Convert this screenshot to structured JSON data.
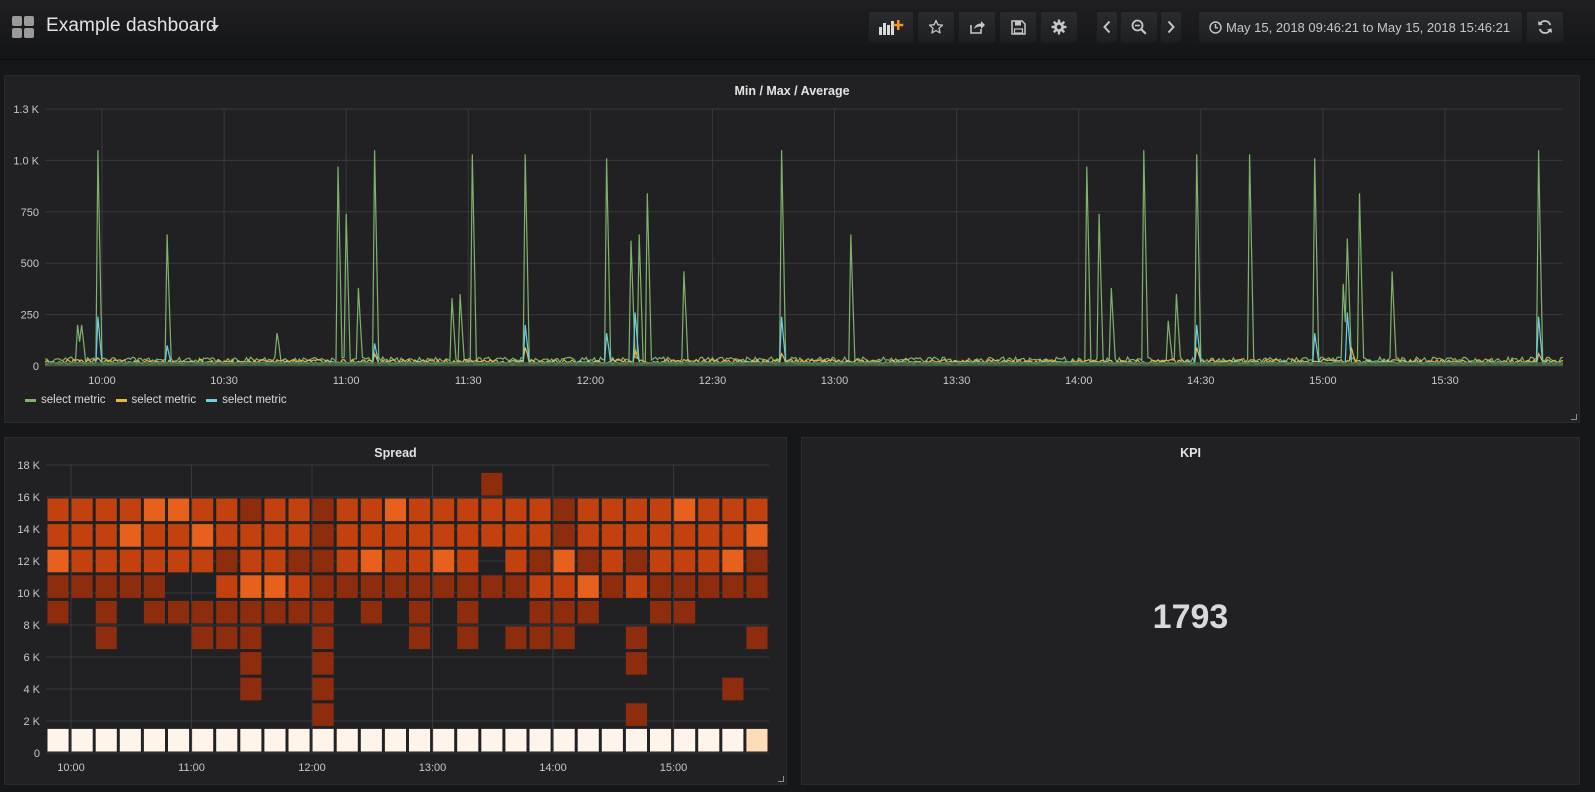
{
  "header": {
    "title": "Example dashboard",
    "time_range": "May 15, 2018 09:46:21 to May 15, 2018 15:46:21",
    "buttons": [
      "add-panel-icon",
      "star-icon",
      "share-icon",
      "save-icon",
      "gear-icon",
      "chevron-left-icon",
      "zoom-out-icon",
      "chevron-right-icon",
      "clock-icon",
      "refresh-icon"
    ]
  },
  "panels": {
    "graph": {
      "title": "Min / Max / Average",
      "legend": [
        {
          "label": "select metric",
          "color": "#7eb26d"
        },
        {
          "label": "select metric",
          "color": "#eab839"
        },
        {
          "label": "select metric",
          "color": "#6ed0e0"
        }
      ]
    },
    "heatmap": {
      "title": "Spread"
    },
    "kpi": {
      "title": "KPI",
      "value": "1793"
    }
  },
  "chart_data": [
    {
      "type": "line",
      "title": "Min / Max / Average",
      "x_ticks": [
        "10:00",
        "10:30",
        "11:00",
        "11:30",
        "12:00",
        "12:30",
        "13:00",
        "13:30",
        "14:00",
        "14:30",
        "15:00",
        "15:30"
      ],
      "y_ticks": [
        "0",
        "250",
        "500",
        "750",
        "1.0 K",
        "1.3 K"
      ],
      "ylim": [
        0,
        1250
      ],
      "xlim_minutes": [
        586,
        959
      ],
      "grid": true,
      "legend_position": "bottom-left",
      "baseline": [
        30,
        22,
        15
      ],
      "series": [
        {
          "name": "select metric",
          "color": "#7eb26d",
          "spikes": [
            [
              594,
              200
            ],
            [
              595,
              200
            ],
            [
              599,
              1050
            ],
            [
              616,
              640
            ],
            [
              643,
              160
            ],
            [
              658,
              970
            ],
            [
              660,
              740
            ],
            [
              663,
              380
            ],
            [
              667,
              1050
            ],
            [
              686,
              330
            ],
            [
              688,
              350
            ],
            [
              691,
              1030
            ],
            [
              704,
              1030
            ],
            [
              724,
              1010
            ],
            [
              730,
              610
            ],
            [
              732,
              640
            ],
            [
              734,
              840
            ],
            [
              743,
              460
            ],
            [
              767,
              1050
            ],
            [
              784,
              640
            ],
            [
              842,
              970
            ],
            [
              845,
              740
            ],
            [
              848,
              380
            ],
            [
              856,
              1050
            ],
            [
              862,
              220
            ],
            [
              864,
              350
            ],
            [
              869,
              1030
            ],
            [
              882,
              1030
            ],
            [
              898,
              1010
            ],
            [
              905,
              400
            ],
            [
              906,
              620
            ],
            [
              909,
              840
            ],
            [
              917,
              460
            ],
            [
              953,
              1050
            ]
          ]
        },
        {
          "name": "select metric",
          "color": "#eab839",
          "spikes": [
            [
              599,
              40
            ],
            [
              667,
              60
            ],
            [
              704,
              90
            ],
            [
              731,
              80
            ],
            [
              767,
              60
            ],
            [
              869,
              90
            ],
            [
              907,
              90
            ],
            [
              953,
              60
            ]
          ]
        },
        {
          "name": "select metric",
          "color": "#6ed0e0",
          "spikes": [
            [
              599,
              240
            ],
            [
              616,
              100
            ],
            [
              667,
              110
            ],
            [
              704,
              200
            ],
            [
              724,
              160
            ],
            [
              731,
              260
            ],
            [
              767,
              240
            ],
            [
              869,
              200
            ],
            [
              898,
              160
            ],
            [
              906,
              260
            ],
            [
              953,
              240
            ]
          ]
        }
      ]
    },
    {
      "type": "heatmap",
      "title": "Spread",
      "x_ticks": [
        "10:00",
        "11:00",
        "12:00",
        "13:00",
        "14:00",
        "15:00"
      ],
      "y_ticks": [
        "0",
        "2 K",
        "4 K",
        "6 K",
        "8 K",
        "10 K",
        "12 K",
        "14 K",
        "16 K",
        "18 K"
      ],
      "ylim": [
        0,
        18000
      ],
      "bucket_size": 1600,
      "columns": 30,
      "intensity_scale": "0 = dark red-brown, 5 = pale cream",
      "cells": [
        [
          0,
          0,
          5
        ],
        [
          0,
          5,
          1
        ],
        [
          0,
          6,
          1
        ],
        [
          0,
          7,
          3
        ],
        [
          0,
          8,
          2
        ],
        [
          0,
          9,
          2
        ],
        [
          1,
          0,
          5
        ],
        [
          1,
          6,
          1
        ],
        [
          1,
          7,
          2
        ],
        [
          1,
          8,
          2
        ],
        [
          1,
          9,
          2
        ],
        [
          2,
          0,
          5
        ],
        [
          2,
          4,
          1
        ],
        [
          2,
          5,
          1
        ],
        [
          2,
          6,
          1
        ],
        [
          2,
          7,
          2
        ],
        [
          2,
          8,
          2
        ],
        [
          2,
          9,
          2
        ],
        [
          3,
          0,
          5
        ],
        [
          3,
          6,
          1
        ],
        [
          3,
          7,
          2
        ],
        [
          3,
          8,
          3
        ],
        [
          3,
          9,
          2
        ],
        [
          4,
          0,
          5
        ],
        [
          4,
          5,
          1
        ],
        [
          4,
          6,
          1
        ],
        [
          4,
          7,
          2
        ],
        [
          4,
          8,
          2
        ],
        [
          4,
          9,
          3
        ],
        [
          5,
          0,
          5
        ],
        [
          5,
          5,
          1
        ],
        [
          5,
          7,
          2
        ],
        [
          5,
          8,
          2
        ],
        [
          5,
          9,
          3
        ],
        [
          6,
          0,
          5
        ],
        [
          6,
          4,
          1
        ],
        [
          6,
          5,
          1
        ],
        [
          6,
          7,
          2
        ],
        [
          6,
          8,
          3
        ],
        [
          6,
          9,
          2
        ],
        [
          7,
          0,
          5
        ],
        [
          7,
          4,
          1
        ],
        [
          7,
          5,
          1
        ],
        [
          7,
          6,
          2
        ],
        [
          7,
          7,
          1
        ],
        [
          7,
          8,
          2
        ],
        [
          7,
          9,
          2
        ],
        [
          8,
          0,
          5
        ],
        [
          8,
          2,
          1
        ],
        [
          8,
          3,
          1
        ],
        [
          8,
          4,
          1
        ],
        [
          8,
          5,
          1
        ],
        [
          8,
          6,
          3
        ],
        [
          8,
          7,
          2
        ],
        [
          8,
          8,
          2
        ],
        [
          8,
          9,
          1
        ],
        [
          9,
          0,
          5
        ],
        [
          9,
          5,
          1
        ],
        [
          9,
          6,
          3
        ],
        [
          9,
          7,
          2
        ],
        [
          9,
          8,
          2
        ],
        [
          9,
          9,
          2
        ],
        [
          10,
          0,
          5
        ],
        [
          10,
          5,
          1
        ],
        [
          10,
          6,
          2
        ],
        [
          10,
          7,
          1
        ],
        [
          10,
          8,
          2
        ],
        [
          10,
          9,
          2
        ],
        [
          11,
          0,
          5
        ],
        [
          11,
          1,
          1
        ],
        [
          11,
          2,
          1
        ],
        [
          11,
          3,
          1
        ],
        [
          11,
          4,
          1
        ],
        [
          11,
          5,
          1
        ],
        [
          11,
          6,
          1
        ],
        [
          11,
          7,
          1
        ],
        [
          11,
          8,
          1
        ],
        [
          11,
          9,
          1
        ],
        [
          12,
          0,
          5
        ],
        [
          12,
          6,
          1
        ],
        [
          12,
          7,
          2
        ],
        [
          12,
          8,
          2
        ],
        [
          12,
          9,
          2
        ],
        [
          13,
          0,
          5
        ],
        [
          13,
          5,
          1
        ],
        [
          13,
          6,
          1
        ],
        [
          13,
          7,
          3
        ],
        [
          13,
          8,
          2
        ],
        [
          13,
          9,
          2
        ],
        [
          14,
          0,
          5
        ],
        [
          14,
          6,
          1
        ],
        [
          14,
          7,
          2
        ],
        [
          14,
          8,
          2
        ],
        [
          14,
          9,
          3
        ],
        [
          15,
          0,
          5
        ],
        [
          15,
          4,
          1
        ],
        [
          15,
          5,
          1
        ],
        [
          15,
          6,
          1
        ],
        [
          15,
          7,
          2
        ],
        [
          15,
          8,
          2
        ],
        [
          15,
          9,
          2
        ],
        [
          16,
          0,
          5
        ],
        [
          16,
          6,
          1
        ],
        [
          16,
          7,
          3
        ],
        [
          16,
          8,
          2
        ],
        [
          16,
          9,
          2
        ],
        [
          17,
          0,
          5
        ],
        [
          17,
          4,
          1
        ],
        [
          17,
          5,
          1
        ],
        [
          17,
          6,
          1
        ],
        [
          17,
          7,
          2
        ],
        [
          17,
          8,
          2
        ],
        [
          17,
          9,
          2
        ],
        [
          18,
          0,
          5
        ],
        [
          18,
          6,
          1
        ],
        [
          18,
          8,
          2
        ],
        [
          18,
          9,
          2
        ],
        [
          18,
          10,
          1
        ],
        [
          19,
          0,
          5
        ],
        [
          19,
          4,
          1
        ],
        [
          19,
          6,
          1
        ],
        [
          19,
          7,
          2
        ],
        [
          19,
          8,
          2
        ],
        [
          19,
          9,
          2
        ],
        [
          20,
          0,
          5
        ],
        [
          20,
          4,
          1
        ],
        [
          20,
          5,
          1
        ],
        [
          20,
          6,
          2
        ],
        [
          20,
          7,
          1
        ],
        [
          20,
          8,
          2
        ],
        [
          20,
          9,
          2
        ],
        [
          21,
          0,
          5
        ],
        [
          21,
          4,
          1
        ],
        [
          21,
          5,
          1
        ],
        [
          21,
          6,
          2
        ],
        [
          21,
          7,
          3
        ],
        [
          21,
          8,
          1
        ],
        [
          21,
          9,
          1
        ],
        [
          22,
          0,
          5
        ],
        [
          22,
          5,
          1
        ],
        [
          22,
          6,
          3
        ],
        [
          22,
          7,
          1
        ],
        [
          22,
          8,
          2
        ],
        [
          22,
          9,
          2
        ],
        [
          23,
          0,
          5
        ],
        [
          23,
          6,
          1
        ],
        [
          23,
          7,
          2
        ],
        [
          23,
          8,
          2
        ],
        [
          23,
          9,
          2
        ],
        [
          24,
          0,
          5
        ],
        [
          24,
          1,
          1
        ],
        [
          24,
          3,
          1
        ],
        [
          24,
          4,
          1
        ],
        [
          24,
          6,
          2
        ],
        [
          24,
          7,
          1
        ],
        [
          24,
          8,
          2
        ],
        [
          24,
          9,
          2
        ],
        [
          25,
          0,
          5
        ],
        [
          25,
          5,
          1
        ],
        [
          25,
          6,
          1
        ],
        [
          25,
          7,
          2
        ],
        [
          25,
          8,
          2
        ],
        [
          25,
          9,
          2
        ],
        [
          26,
          0,
          5
        ],
        [
          26,
          5,
          1
        ],
        [
          26,
          6,
          1
        ],
        [
          26,
          7,
          2
        ],
        [
          26,
          8,
          2
        ],
        [
          26,
          9,
          3
        ],
        [
          27,
          0,
          5
        ],
        [
          27,
          6,
          1
        ],
        [
          27,
          7,
          2
        ],
        [
          27,
          8,
          2
        ],
        [
          27,
          9,
          2
        ],
        [
          28,
          0,
          5
        ],
        [
          28,
          2,
          1
        ],
        [
          28,
          6,
          1
        ],
        [
          28,
          7,
          3
        ],
        [
          28,
          8,
          2
        ],
        [
          28,
          9,
          2
        ],
        [
          29,
          0,
          4
        ],
        [
          29,
          4,
          1
        ],
        [
          29,
          6,
          1
        ],
        [
          29,
          7,
          1
        ],
        [
          29,
          8,
          3
        ],
        [
          29,
          9,
          2
        ]
      ]
    }
  ]
}
